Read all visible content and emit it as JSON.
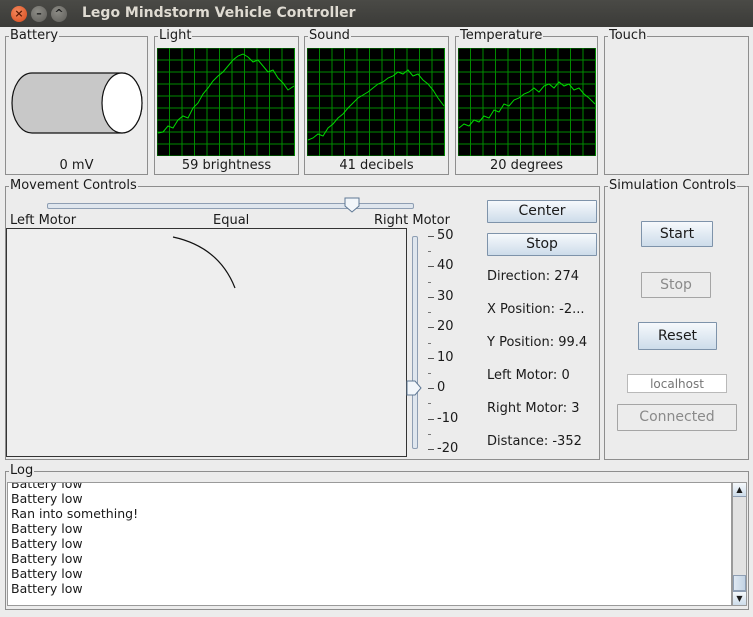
{
  "window": {
    "title": "Lego Mindstorm Vehicle Controller",
    "close_glyph": "×",
    "min_glyph": "–",
    "max_glyph": "^"
  },
  "sensors": {
    "battery": {
      "title": "Battery",
      "value": "0 mV"
    },
    "light": {
      "title": "Light",
      "value": "59 brightness"
    },
    "sound": {
      "title": "Sound",
      "value": "41 decibels"
    },
    "temperature": {
      "title": "Temperature",
      "value": "20 degrees"
    },
    "touch": {
      "title": "Touch"
    }
  },
  "movement": {
    "title": "Movement Controls",
    "left_label": "Left Motor",
    "center_label": "Equal",
    "right_label": "Right Motor",
    "balance": 0.83,
    "center_button": "Center",
    "stop_button": "Stop",
    "speed_value": 0,
    "speed_ticks": [
      "50",
      "40",
      "30",
      "20",
      "10",
      "0",
      "-10",
      "-20"
    ],
    "direction": "Direction: 274",
    "x_position": "X Position: -2...",
    "y_position": "Y Position: 99.4",
    "left_motor": "Left Motor: 0",
    "right_motor": "Right Motor: 3",
    "distance": "Distance: -352"
  },
  "simulation": {
    "title": "Simulation Controls",
    "start": "Start",
    "stop": "Stop",
    "reset": "Reset",
    "host_placeholder": "localhost",
    "connected": "Connected"
  },
  "log": {
    "title": "Log",
    "lines": [
      "Battery low",
      "Battery low",
      "Ran into something!",
      "Battery low",
      "Battery low",
      "Battery low",
      "Battery low",
      "Battery low"
    ]
  },
  "colors": {
    "trace": "#00d800",
    "grid": "#008a00",
    "accent": "#7e93aa"
  }
}
